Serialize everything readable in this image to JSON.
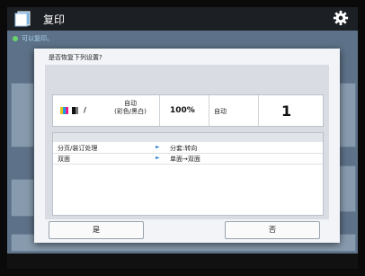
{
  "app": {
    "title": "复印"
  },
  "status": {
    "text": "可以复印。"
  },
  "dialog": {
    "title": "是否恢复下列设置?",
    "summary": {
      "color_mode": "/",
      "paper_line1": "自动",
      "paper_line2": "(彩色/黑白)",
      "ratio": "100%",
      "paper_select": "自动",
      "copies": "1"
    },
    "settings": [
      {
        "label": "分页/装订处理",
        "value": "分套:转向"
      },
      {
        "label": "双面",
        "value": "单面→双面"
      }
    ],
    "buttons": {
      "yes": "是",
      "no": "否"
    }
  },
  "colors": {
    "accent": "#2a7fd0",
    "status_dot": "#6bd36b"
  }
}
